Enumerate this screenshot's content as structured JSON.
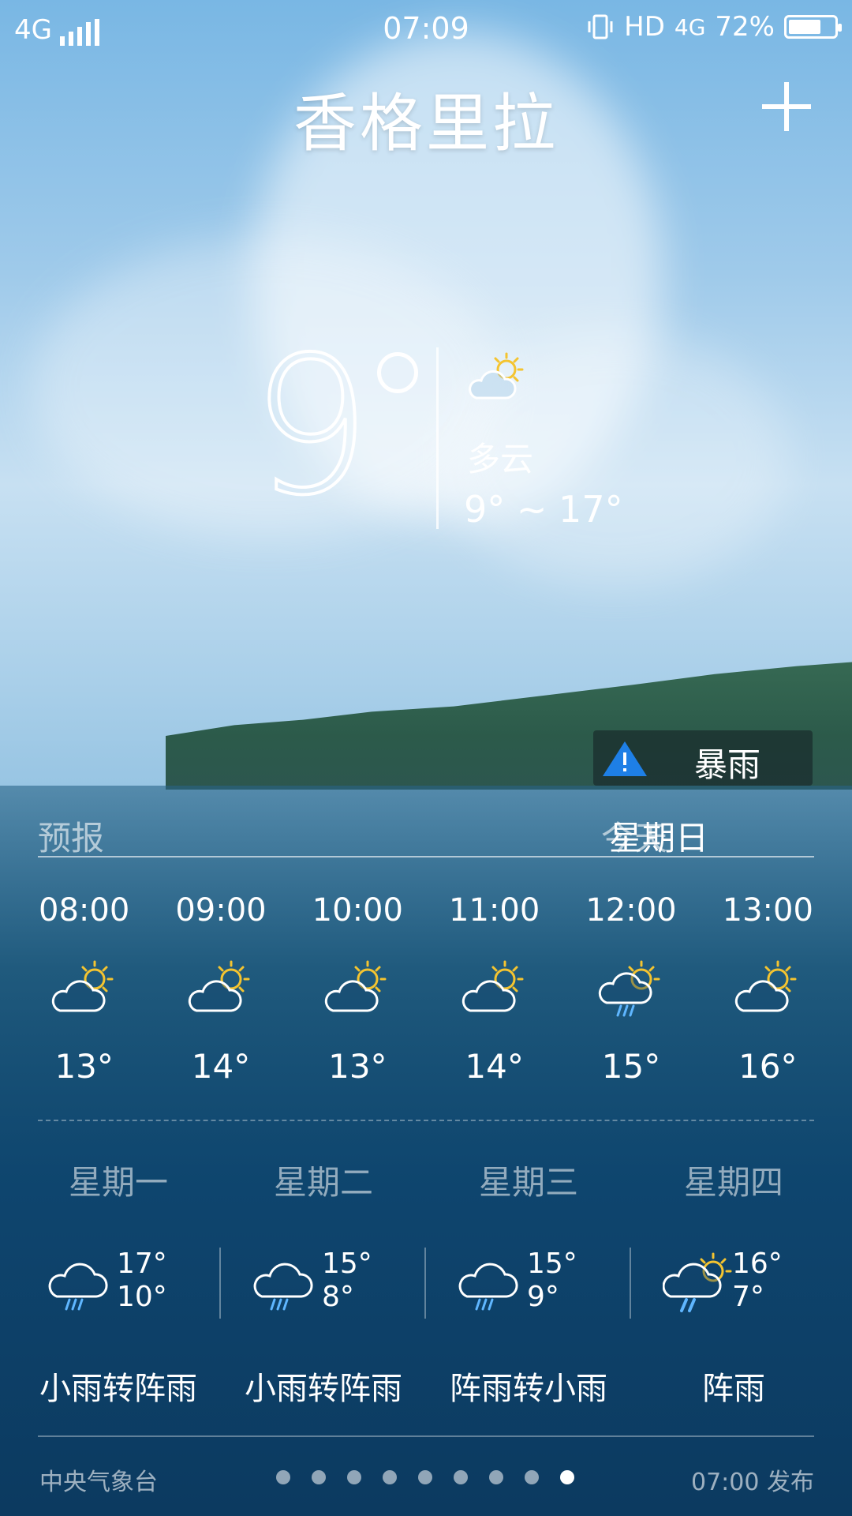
{
  "status_bar": {
    "network": "4G",
    "time": "07:09",
    "hd": "HD",
    "network_right": "4G",
    "battery": "72%",
    "battery_level": 0.72
  },
  "header": {
    "city": "香格里拉",
    "add_icon": "plus-icon"
  },
  "current": {
    "temp": "9",
    "condition": "多云",
    "range": "9° ~ 17°",
    "icon": "partly-cloudy-icon"
  },
  "alert": {
    "label": "暴雨",
    "icon": "warning-icon",
    "color": "#1e7fe6"
  },
  "forecast": {
    "title": "预报",
    "today": "今天",
    "day": "星期日"
  },
  "hourly": [
    {
      "time": "08:00",
      "temp": "13°",
      "icon": "partly-cloudy-icon"
    },
    {
      "time": "09:00",
      "temp": "14°",
      "icon": "partly-cloudy-icon"
    },
    {
      "time": "10:00",
      "temp": "13°",
      "icon": "partly-cloudy-icon"
    },
    {
      "time": "11:00",
      "temp": "14°",
      "icon": "partly-cloudy-icon"
    },
    {
      "time": "12:00",
      "temp": "15°",
      "icon": "sun-rain-icon"
    },
    {
      "time": "13:00",
      "temp": "16°",
      "icon": "partly-cloudy-icon"
    }
  ],
  "daily": [
    {
      "name": "星期一",
      "hi": "17°",
      "lo": "10°",
      "cond": "小雨转阵雨",
      "icon": "rain-cloud-icon"
    },
    {
      "name": "星期二",
      "hi": "15°",
      "lo": "8°",
      "cond": "小雨转阵雨",
      "icon": "rain-cloud-icon"
    },
    {
      "name": "星期三",
      "hi": "15°",
      "lo": "9°",
      "cond": "阵雨转小雨",
      "icon": "rain-cloud-icon"
    },
    {
      "name": "星期四",
      "hi": "16°",
      "lo": "7°",
      "cond": "阵雨",
      "icon": "sun-rain-icon"
    }
  ],
  "footer": {
    "source": "中央气象台",
    "published": "07:00 发布",
    "page_count": 9,
    "active_page": 9
  },
  "colors": {
    "sun": "#f4c430",
    "rain": "#5fb6ff",
    "alert": "#1e7fe6"
  }
}
